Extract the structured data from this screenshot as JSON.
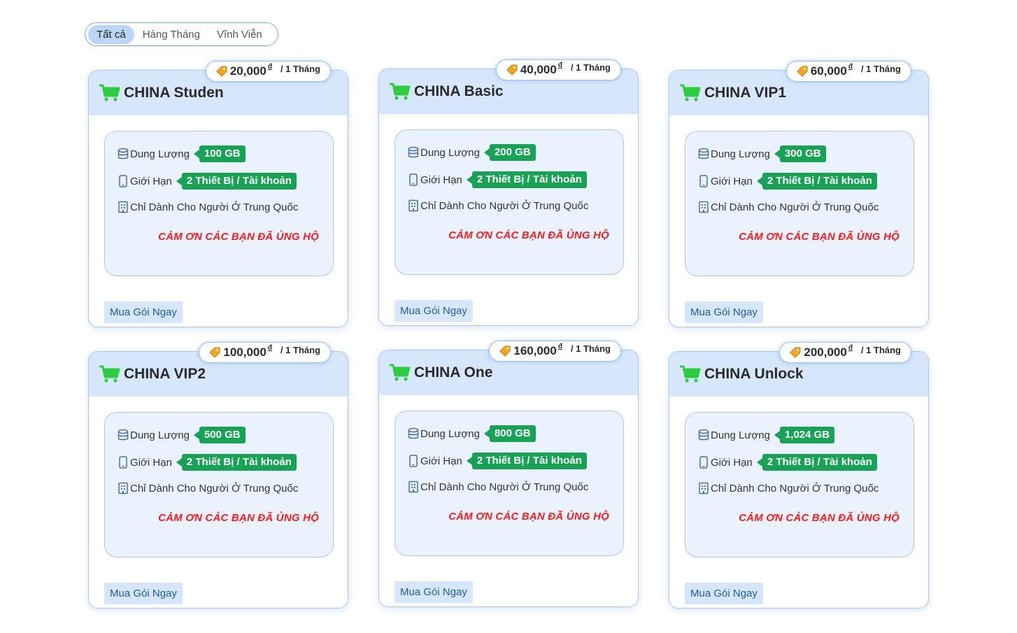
{
  "tabs": [
    {
      "label": "Tất cả",
      "active": true
    },
    {
      "label": "Hàng Tháng",
      "active": false
    },
    {
      "label": "Vĩnh Viễn",
      "active": false
    }
  ],
  "common": {
    "currency": "đ",
    "period": "/ 1 Tháng",
    "storage_label": "Dung Lượng",
    "limit_label": "Giới Hạn",
    "limit_value": "2 Thiết Bị / Tài khoản",
    "region_note": "Chỉ Dành Cho Người Ở Trung Quốc",
    "thanks": "CẢM ƠN CÁC BẠN ĐÃ ỦNG HỘ",
    "buy_label": "Mua Gói Ngay"
  },
  "plans": [
    {
      "name": "CHINA Studen",
      "price": "20,000",
      "storage": "100 GB"
    },
    {
      "name": "CHINA Basic",
      "price": "40,000",
      "storage": "200 GB"
    },
    {
      "name": "CHINA VIP1",
      "price": "60,000",
      "storage": "300 GB"
    },
    {
      "name": "CHINA VIP2",
      "price": "100,000",
      "storage": "500 GB"
    },
    {
      "name": "CHINA One",
      "price": "160,000",
      "storage": "800 GB"
    },
    {
      "name": "CHINA Unlock",
      "price": "200,000",
      "storage": "1,024 GB"
    }
  ],
  "colors": {
    "header_bg": "#d6e7fb",
    "badge_green": "#17a255",
    "thanks_red": "#ff1a1a",
    "cart_green": "#2ecc40",
    "tag_orange": "#f5a623"
  }
}
